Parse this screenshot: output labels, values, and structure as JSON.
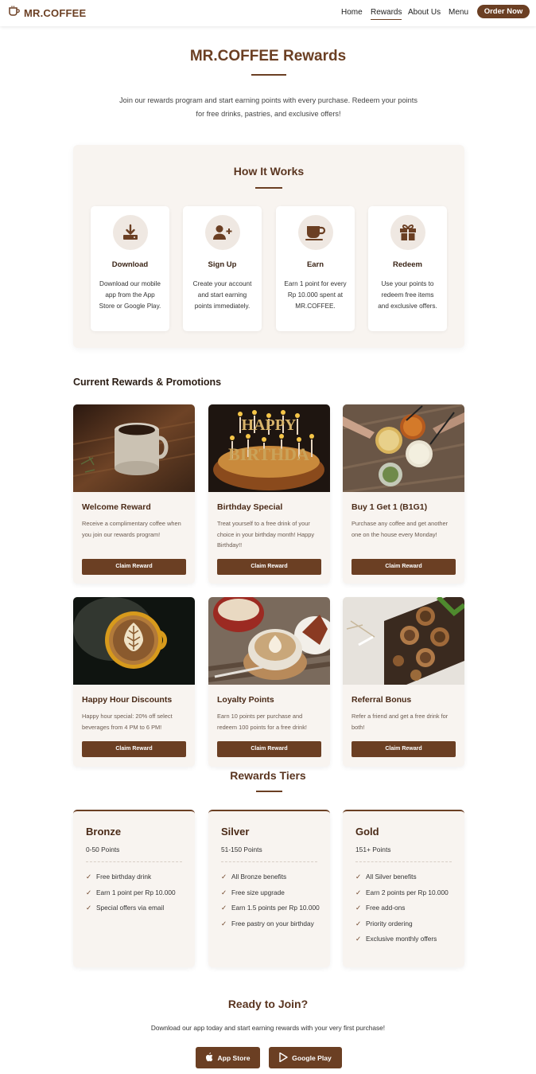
{
  "nav": {
    "brand": "MR.COFFEE",
    "links": [
      "Home",
      "Rewards",
      "About Us",
      "Menu"
    ],
    "active": "Rewards",
    "order_label": "Order Now"
  },
  "hero": {
    "title": "MR.COFFEE Rewards",
    "subtitle": "Join our rewards program and start earning points with every purchase. Redeem your points for free drinks, pastries, and exclusive offers!"
  },
  "how_it_works": {
    "title": "How It Works",
    "steps": [
      {
        "icon": "download-icon",
        "title": "Download",
        "desc": "Download our mobile app from the App Store or Google Play."
      },
      {
        "icon": "user-plus-icon",
        "title": "Sign Up",
        "desc": "Create your account and start earning points immediately."
      },
      {
        "icon": "coffee-cup-icon",
        "title": "Earn",
        "desc": "Earn 1 point for every Rp 10.000 spent at MR.COFFEE."
      },
      {
        "icon": "gift-icon",
        "title": "Redeem",
        "desc": "Use your points to redeem free items and exclusive offers."
      }
    ]
  },
  "promotions": {
    "title": "Current Rewards & Promotions",
    "claim_label": "Claim Reward",
    "items": [
      {
        "title": "Welcome Reward",
        "desc": "Receive a complimentary coffee when you join our rewards program!",
        "image": "coffee-mug-photo"
      },
      {
        "title": "Birthday Special",
        "desc": "Treat yourself to a free drink of your choice in your birthday month! Happy Birthday!!",
        "image": "birthday-cake-photo"
      },
      {
        "title": "Buy 1 Get 1 (B1G1)",
        "desc": "Purchase any coffee and get another one on the house every Monday!",
        "image": "drinks-toast-photo"
      },
      {
        "title": "Happy Hour Discounts",
        "desc": "Happy hour special: 20% off select beverages from 4 PM to 6 PM!",
        "image": "latte-art-photo"
      },
      {
        "title": "Loyalty Points",
        "desc": "Earn 10 points per purchase and redeem 100 points for a free drink!",
        "image": "cappuccino-cake-photo"
      },
      {
        "title": "Referral Bonus",
        "desc": "Refer a friend and get a free drink for both!",
        "image": "pastries-photo"
      }
    ]
  },
  "tiers": {
    "title": "Rewards Tiers",
    "items": [
      {
        "name": "Bronze",
        "points": "0-50 Points",
        "benefits": [
          "Free birthday drink",
          "Earn 1 point per Rp 10.000",
          "Special offers via email"
        ]
      },
      {
        "name": "Silver",
        "points": "51-150 Points",
        "benefits": [
          "All Bronze benefits",
          "Free size upgrade",
          "Earn 1.5 points per Rp 10.000",
          "Free pastry on your birthday"
        ]
      },
      {
        "name": "Gold",
        "points": "151+ Points",
        "benefits": [
          "All Silver benefits",
          "Earn 2 points per Rp 10.000",
          "Free add-ons",
          "Priority ordering",
          "Exclusive monthly offers"
        ]
      }
    ]
  },
  "cta": {
    "title": "Ready to Join?",
    "subtitle": "Download our app today and start earning rewards with your very first purchase!",
    "app_store_label": "App Store",
    "google_play_label": "Google Play"
  },
  "colors": {
    "brand": "#6b3f23",
    "panel": "#f8f4f0",
    "icon_circle": "#efe8e2"
  }
}
